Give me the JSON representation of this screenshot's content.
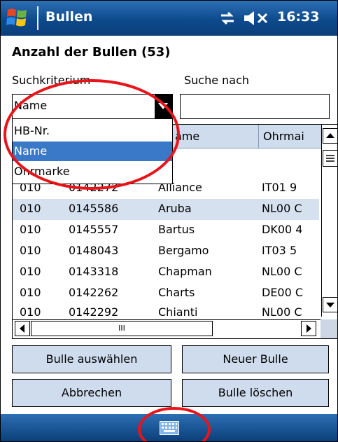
{
  "titlebar": {
    "app_title": "Bullen",
    "time": "16:33"
  },
  "header": {
    "count_label": "Anzahl der Bullen (53)"
  },
  "search": {
    "criterion_label": "Suchkriterium",
    "search_label": "Suche nach",
    "criterion_value": "Name",
    "search_value": ""
  },
  "dropdown": {
    "options": [
      "HB-Nr.",
      "Name",
      "Ohrmarke"
    ],
    "selected": "Name"
  },
  "grid": {
    "columns": [
      "",
      "",
      "ame",
      "Ohrmai"
    ],
    "rows": [
      [
        "010",
        "0142272",
        "Alliance",
        "IT01 9"
      ],
      [
        "010",
        "0145586",
        "Aruba",
        "NL00 C"
      ],
      [
        "010",
        "0145557",
        "Bartus",
        "DK00 4"
      ],
      [
        "010",
        "0148043",
        "Bergamo",
        "IT03 5"
      ],
      [
        "010",
        "0143318",
        "Chapman",
        "NL00 C"
      ],
      [
        "010",
        "0142262",
        "Charts",
        "DE00 C"
      ],
      [
        "010",
        "0142292",
        "Chianti",
        "NL00 C"
      ]
    ],
    "selected_row": 1,
    "hscroll_thumb_glyph": "III"
  },
  "buttons": {
    "select": "Bulle auswählen",
    "new": "Neuer Bulle",
    "cancel": "Abbrechen",
    "delete": "Bulle löschen"
  },
  "colors": {
    "titlebar": "#0d4a8c",
    "button_face": "#cfdced",
    "selection": "#3a79c7",
    "annotation": "#e8141a"
  },
  "icons": [
    "windows-logo-icon",
    "connectivity-icon",
    "speaker-muted-icon",
    "keyboard-icon"
  ]
}
